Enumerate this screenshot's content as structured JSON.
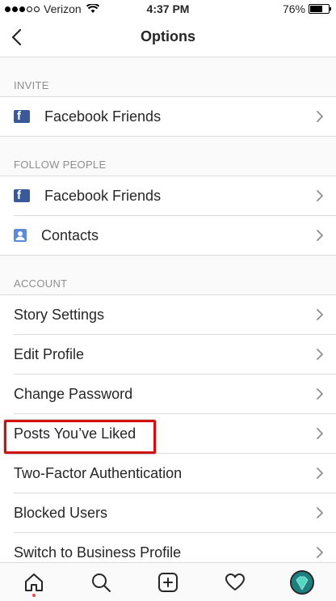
{
  "status_bar": {
    "carrier": "Verizon",
    "time": "4:37 PM",
    "battery": "76%",
    "battery_level": 0.76
  },
  "header": {
    "title": "Options",
    "back_icon": "chevron-left-icon"
  },
  "sections": [
    {
      "header": "INVITE",
      "rows": [
        {
          "label": "Facebook Friends",
          "icon": "facebook-icon"
        }
      ]
    },
    {
      "header": "FOLLOW PEOPLE",
      "rows": [
        {
          "label": "Facebook Friends",
          "icon": "facebook-icon"
        },
        {
          "label": "Contacts",
          "icon": "contacts-icon"
        }
      ]
    },
    {
      "header": "ACCOUNT",
      "rows": [
        {
          "label": "Story Settings"
        },
        {
          "label": "Edit Profile"
        },
        {
          "label": "Change Password"
        },
        {
          "label": "Posts You’ve Liked",
          "highlighted": true
        },
        {
          "label": "Two-Factor Authentication"
        },
        {
          "label": "Blocked Users"
        },
        {
          "label": "Switch to Business Profile"
        }
      ]
    }
  ],
  "tab_bar": {
    "tabs": [
      "home-icon",
      "search-icon",
      "add-post-icon",
      "activity-heart-icon",
      "profile-avatar"
    ],
    "active": "home-icon"
  },
  "colors": {
    "highlight": "#d10f0f",
    "facebook": "#3b5998",
    "notification_dot": "#ed4956"
  }
}
